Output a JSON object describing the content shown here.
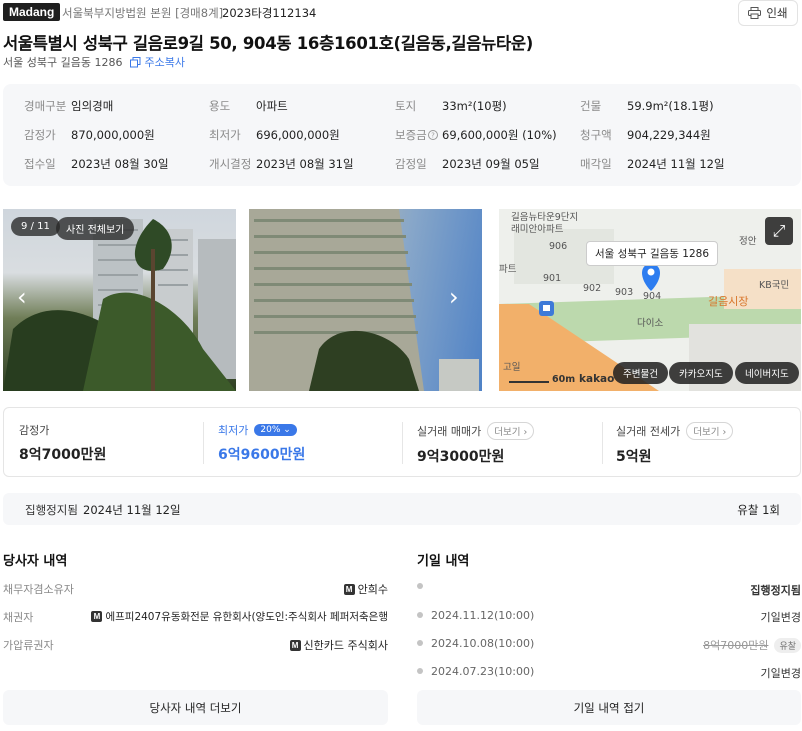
{
  "header": {
    "logo": "Madang",
    "court": "서울북부지방법원 본원 [경매8계]",
    "case_number": "2023타경112134",
    "print_label": "인쇄"
  },
  "title": "서울특별시 성북구 길음로9길 50, 904동 16층1601호(길음동,길음뉴타운)",
  "sub_address": "서울 성북구 길음동 1286",
  "copy_label": "주소복사",
  "info": {
    "auction_type_label": "경매구분",
    "auction_type": "임의경매",
    "usage_label": "용도",
    "usage": "아파트",
    "land_label": "토지",
    "land": "33m²(10평)",
    "building_label": "건물",
    "building": "59.9m²(18.1평)",
    "appraisal_label": "감정가",
    "appraisal": "870,000,000원",
    "minimum_label": "최저가",
    "minimum": "696,000,000원",
    "deposit_label": "보증금",
    "deposit": "69,600,000원 (10%)",
    "claim_label": "청구액",
    "claim": "904,229,344원",
    "received_label": "접수일",
    "received": "2023년 08월 30일",
    "start_label": "개시결정",
    "start": "2023년 08월 31일",
    "appraisal_date_label": "감정일",
    "appraisal_date": "2023년 09월 05일",
    "sale_date_label": "매각일",
    "sale_date": "2024년 11월 12일"
  },
  "photos": {
    "counter": "9 / 11",
    "view_all": "사진 전체보기"
  },
  "map": {
    "popup": "서울 성북구 길음동 1286",
    "labels": [
      "길음뉴타운9단지",
      "래미안아파트",
      "906",
      "901",
      "902",
      "903",
      "904",
      "파트",
      "다이소",
      "길음시장",
      "KB국민",
      "정안",
      "고일",
      "60m",
      "kakao"
    ],
    "btn_nearby": "주변물건",
    "btn_kakao": "카카오지도",
    "btn_naver": "네이버지도"
  },
  "prices": {
    "appraisal_label": "감정가",
    "appraisal_value": "8억7000만원",
    "minimum_label": "최저가",
    "minimum_percent": "20%",
    "minimum_value": "6억9600만원",
    "trade_label": "실거래 매매가",
    "trade_more": "더보기",
    "trade_value": "9억3000만원",
    "jeonse_label": "실거래 전세가",
    "jeonse_more": "더보기",
    "jeonse_value": "5억원"
  },
  "stay": {
    "label": "집행정지됨",
    "date": "2024년 11월 12일",
    "fail_count": "유찰 1회"
  },
  "parties": {
    "title": "당사자 내역",
    "rows": [
      {
        "label": "채무자겸소유자",
        "badge": "M",
        "value": "안희수"
      },
      {
        "label": "채권자",
        "badge": "M",
        "value": "에프피2407유동화전문 유한회사(양도인:주식회사 페퍼저축은행"
      },
      {
        "label": "가압류권자",
        "badge": "M",
        "value": "신한카드 주식회사"
      }
    ],
    "more_button": "당사자 내역 더보기"
  },
  "history": {
    "title": "기일 내역",
    "rows": [
      {
        "date": "",
        "value": "집행정지됨",
        "chip": ""
      },
      {
        "date": "2024.11.12(10:00)",
        "value": "기일변경",
        "chip": ""
      },
      {
        "date": "2024.10.08(10:00)",
        "value": "8억7000만원",
        "chip": "유찰"
      },
      {
        "date": "2024.07.23(10:00)",
        "value": "기일변경",
        "chip": ""
      }
    ],
    "collapse_button": "기일 내역 접기"
  },
  "colors": {
    "accent_blue": "#3a78e8",
    "panel_bg": "#f6f7f9",
    "map_road": "#f2b06a",
    "map_pin": "#2d7df0"
  }
}
